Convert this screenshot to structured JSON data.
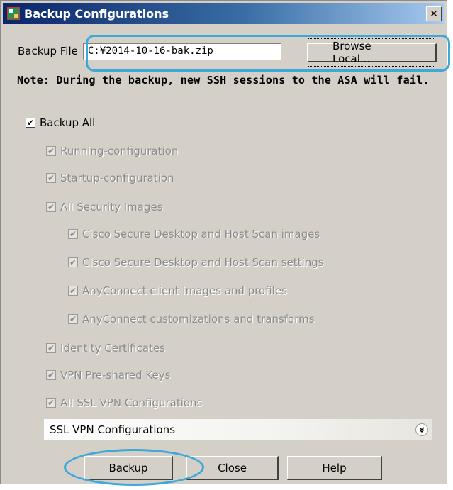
{
  "window": {
    "title": "Backup Configurations",
    "close_glyph": "✕"
  },
  "file": {
    "label": "Backup File",
    "value": "C:¥2014-10-16-bak.zip",
    "browse_label": "Browse Local..."
  },
  "note": "Note: During the backup, new SSH sessions to the ASA will fail.",
  "options": {
    "backup_all": "Backup All",
    "running": "Running-configuration",
    "startup": "Startup-configuration",
    "security_images": "All Security Images",
    "csd_images": "Cisco Secure Desktop and Host Scan images",
    "csd_settings": "Cisco Secure Desktop and Host Scan settings",
    "anyconnect_images": "AnyConnect client images and profiles",
    "anyconnect_custom": "AnyConnect customizations and transforms",
    "identity_certs": "Identity Certificates",
    "vpn_keys": "VPN Pre-shared Keys",
    "ssl_vpn": "All SSL VPN Configurations"
  },
  "ssl_section": {
    "label": "SSL VPN Configurations",
    "icon": "expand-icon"
  },
  "buttons": {
    "backup": "Backup",
    "close": "Close",
    "help": "Help"
  },
  "colors": {
    "highlight": "#3ea8d8",
    "title_bar": "#0a246a",
    "dialog_bg": "#d4d0c8"
  }
}
